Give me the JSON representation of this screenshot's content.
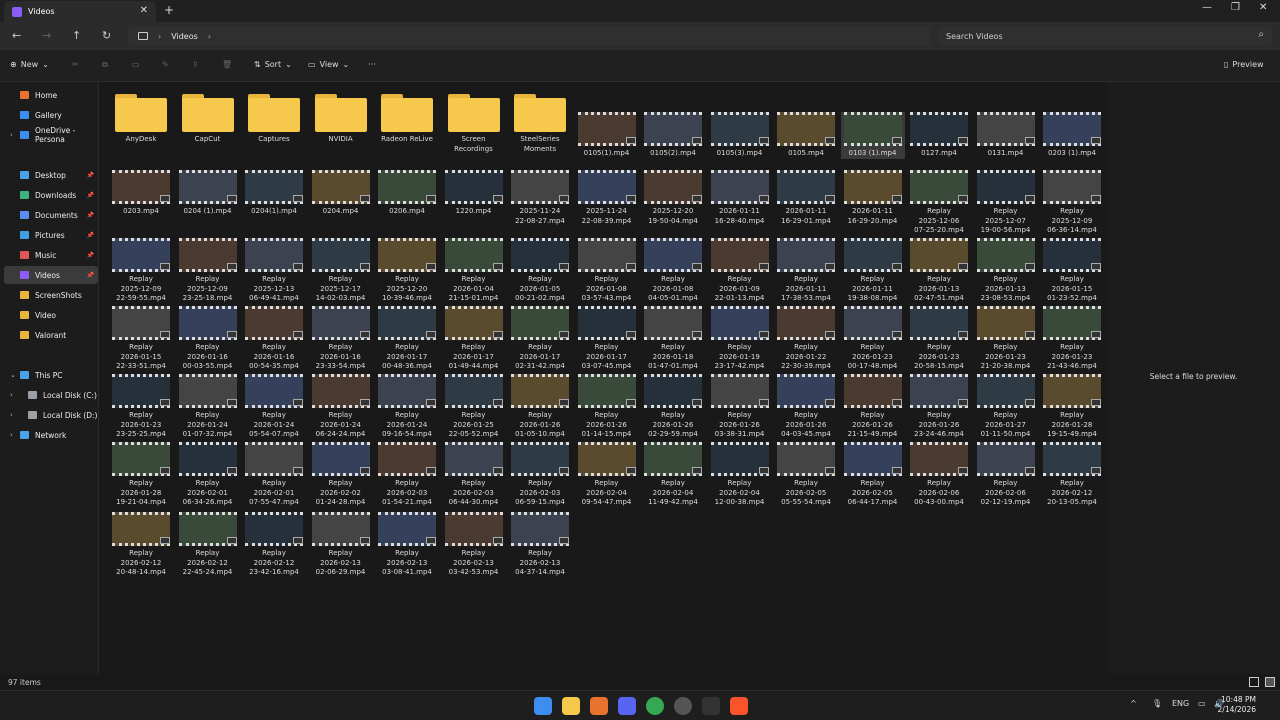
{
  "tab": {
    "title": "Videos"
  },
  "address": {
    "crumb": "Videos"
  },
  "search": {
    "placeholder": "Search Videos"
  },
  "toolbar": {
    "new": "New",
    "sort": "Sort",
    "view": "View",
    "more": "···",
    "preview": "Preview"
  },
  "sidebar": {
    "items": [
      {
        "label": "Home",
        "color": "#e8732e"
      },
      {
        "label": "Gallery",
        "color": "#3d8ef0"
      },
      {
        "label": "OneDrive - Persona",
        "color": "#3d8ef0"
      },
      {
        "label": "Desktop",
        "color": "#4aa3e8"
      },
      {
        "label": "Downloads",
        "color": "#3fb37f"
      },
      {
        "label": "Documents",
        "color": "#5b8def"
      },
      {
        "label": "Pictures",
        "color": "#43a0e0"
      },
      {
        "label": "Music",
        "color": "#e05555"
      },
      {
        "label": "Videos",
        "color": "#8b5cf6"
      },
      {
        "label": "ScreenShots",
        "color": "#e8b43a"
      },
      {
        "label": "Video",
        "color": "#e8b43a"
      },
      {
        "label": "Valorant",
        "color": "#e8b43a"
      },
      {
        "label": "This PC",
        "color": "#4aa3e8"
      },
      {
        "label": "Local Disk (C:)",
        "color": "#9aa0a6"
      },
      {
        "label": "Local Disk (D:)",
        "color": "#9aa0a6"
      },
      {
        "label": "Network",
        "color": "#4aa3e8"
      }
    ]
  },
  "folders": [
    {
      "name": "AnyDesk"
    },
    {
      "name": "CapCut"
    },
    {
      "name": "Captures"
    },
    {
      "name": "NVIDIA"
    },
    {
      "name": "Radeon ReLive"
    },
    {
      "name": "Screen\nRecordings"
    },
    {
      "name": "SteelSeries\nMoments"
    }
  ],
  "files": [
    "0105(1).mp4",
    "0105(2).mp4",
    "0105(3).mp4",
    "0105.mp4",
    "0103 (1).mp4",
    "0127.mp4",
    "0131.mp4",
    "0203 (1).mp4",
    "0203.mp4",
    "0204 (1).mp4",
    "0204(1).mp4",
    "0204.mp4",
    "0206.mp4",
    "1220.mp4",
    "2025-11-24\n22-08-27.mp4",
    "2025-11-24\n22-08-39.mp4",
    "2025-12-20\n19-50-04.mp4",
    "2026-01-11\n16-28-40.mp4",
    "2026-01-11\n16-29-01.mp4",
    "2026-01-11\n16-29-20.mp4",
    "Replay\n2025-12-06\n07-25-20.mp4",
    "Replay\n2025-12-07\n19-00-56.mp4",
    "Replay\n2025-12-09\n06-36-14.mp4",
    "Replay\n2025-12-09\n22-59-55.mp4",
    "Replay\n2025-12-09\n23-25-18.mp4",
    "Replay\n2025-12-13\n06-49-41.mp4",
    "Replay\n2025-12-17\n14-02-03.mp4",
    "Replay\n2025-12-20\n10-39-46.mp4",
    "Replay\n2026-01-04\n21-15-01.mp4",
    "Replay\n2026-01-05\n00-21-02.mp4",
    "Replay\n2026-01-08\n03-57-43.mp4",
    "Replay\n2026-01-08\n04-05-01.mp4",
    "Replay\n2026-01-09\n22-01-13.mp4",
    "Replay\n2026-01-11\n17-38-53.mp4",
    "Replay\n2026-01-11\n19-38-08.mp4",
    "Replay\n2026-01-13\n02-47-51.mp4",
    "Replay\n2026-01-13\n23-08-53.mp4",
    "Replay\n2026-01-15\n01-23-52.mp4",
    "Replay\n2026-01-15\n22-33-51.mp4",
    "Replay\n2026-01-16\n00-03-55.mp4",
    "Replay\n2026-01-16\n00-54-35.mp4",
    "Replay\n2026-01-16\n23-33-54.mp4",
    "Replay\n2026-01-17\n00-48-36.mp4",
    "Replay\n2026-01-17\n01-49-44.mp4",
    "Replay\n2026-01-17\n02-31-42.mp4",
    "Replay\n2026-01-17\n03-07-45.mp4",
    "Replay\n2026-01-18\n01-47-01.mp4",
    "Replay\n2026-01-19\n23-17-42.mp4",
    "Replay\n2026-01-22\n22-30-39.mp4",
    "Replay\n2026-01-23\n00-17-48.mp4",
    "Replay\n2026-01-23\n20-58-15.mp4",
    "Replay\n2026-01-23\n21-20-38.mp4",
    "Replay\n2026-01-23\n21-43-46.mp4",
    "Replay\n2026-01-23\n23-25-25.mp4",
    "Replay\n2026-01-24\n01-07-32.mp4",
    "Replay\n2026-01-24\n05-54-07.mp4",
    "Replay\n2026-01-24\n06-24-24.mp4",
    "Replay\n2026-01-24\n09-16-54.mp4",
    "Replay\n2026-01-25\n22-05-52.mp4",
    "Replay\n2026-01-26\n01-05-10.mp4",
    "Replay\n2026-01-26\n01-14-15.mp4",
    "Replay\n2026-01-26\n02-29-59.mp4",
    "Replay\n2026-01-26\n03-38-31.mp4",
    "Replay\n2026-01-26\n04-03-45.mp4",
    "Replay\n2026-01-26\n21-15-49.mp4",
    "Replay\n2026-01-26\n23-24-46.mp4",
    "Replay\n2026-01-27\n01-11-50.mp4",
    "Replay\n2026-01-28\n19-15-49.mp4",
    "Replay\n2026-01-28\n19-21-04.mp4",
    "Replay\n2026-02-01\n06-34-26.mp4",
    "Replay\n2026-02-01\n07-55-47.mp4",
    "Replay\n2026-02-02\n01-24-28.mp4",
    "Replay\n2026-02-03\n01-54-21.mp4",
    "Replay\n2026-02-03\n06-44-30.mp4",
    "Replay\n2026-02-03\n06-59-15.mp4",
    "Replay\n2026-02-04\n09-54-47.mp4",
    "Replay\n2026-02-04\n11-49-42.mp4",
    "Replay\n2026-02-04\n12-00-38.mp4",
    "Replay\n2026-02-05\n05-55-54.mp4",
    "Replay\n2026-02-05\n06-44-17.mp4",
    "Replay\n2026-02-06\n00-43-00.mp4",
    "Replay\n2026-02-06\n02-12-19.mp4",
    "Replay\n2026-02-12\n20-13-05.mp4",
    "Replay\n2026-02-12\n20-48-14.mp4",
    "Replay\n2026-02-12\n22-45-24.mp4",
    "Replay\n2026-02-12\n23-42-16.mp4",
    "Replay\n2026-02-13\n02-06-29.mp4",
    "Replay\n2026-02-13\n03-08-41.mp4",
    "Replay\n2026-02-13\n03-42-53.mp4",
    "Replay\n2026-02-13\n04-37-14.mp4"
  ],
  "preview": {
    "message": "Select a file to preview."
  },
  "status": {
    "count": "97 items"
  },
  "taskbar": {
    "lang": "ENG",
    "time": "10:48 PM",
    "date": "2/14/2026"
  }
}
